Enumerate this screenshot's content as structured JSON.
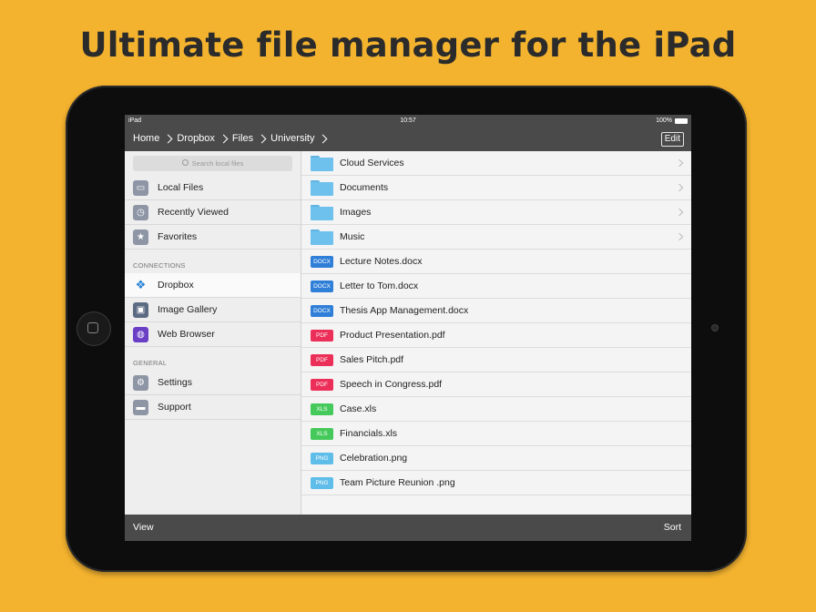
{
  "headline": "Ultimate file manager for the iPad",
  "status_bar": {
    "carrier": "iPad",
    "time": "10:57",
    "battery": "100%"
  },
  "nav": {
    "breadcrumbs": [
      "Home",
      "Dropbox",
      "Files",
      "University"
    ],
    "edit_label": "Edit"
  },
  "sidebar": {
    "search_placeholder": "Search local files",
    "items": [
      {
        "label": "Local Files",
        "icon": "folder-icon",
        "color": "#8e96a6"
      },
      {
        "label": "Recently Viewed",
        "icon": "clock-icon",
        "color": "#8e96a6"
      },
      {
        "label": "Favorites",
        "icon": "star-icon",
        "color": "#8e96a6"
      }
    ],
    "connections_header": "CONNECTIONS",
    "connections": [
      {
        "label": "Dropbox",
        "icon": "dropbox-icon",
        "color": "#2b84d8",
        "selected": true
      },
      {
        "label": "Image Gallery",
        "icon": "image-icon",
        "color": "#5b6b82"
      },
      {
        "label": "Web Browser",
        "icon": "globe-icon",
        "color": "#6a3fc6"
      }
    ],
    "general_header": "GENERAL",
    "general": [
      {
        "label": "Settings",
        "icon": "gear-icon",
        "color": "#8e96a6"
      },
      {
        "label": "Support",
        "icon": "chat-icon",
        "color": "#8e96a6"
      }
    ]
  },
  "files": [
    {
      "name": "Cloud Services",
      "type": "folder"
    },
    {
      "name": "Documents",
      "type": "folder"
    },
    {
      "name": "Images",
      "type": "folder"
    },
    {
      "name": "Music",
      "type": "folder"
    },
    {
      "name": "Lecture Notes.docx",
      "type": "DOCX",
      "color": "#2f7fd8"
    },
    {
      "name": "Letter to Tom.docx",
      "type": "DOCX",
      "color": "#2f7fd8"
    },
    {
      "name": "Thesis App Management.docx",
      "type": "DOCX",
      "color": "#2f7fd8"
    },
    {
      "name": "Product Presentation.pdf",
      "type": "PDF",
      "color": "#ec2f59"
    },
    {
      "name": "Sales Pitch.pdf",
      "type": "PDF",
      "color": "#ec2f59"
    },
    {
      "name": "Speech in Congress.pdf",
      "type": "PDF",
      "color": "#ec2f59"
    },
    {
      "name": "Case.xls",
      "type": "XLS",
      "color": "#45c95a"
    },
    {
      "name": "Financials.xls",
      "type": "XLS",
      "color": "#45c95a"
    },
    {
      "name": "Celebration.png",
      "type": "PNG",
      "color": "#5fbde9"
    },
    {
      "name": "Team Picture Reunion .png",
      "type": "PNG",
      "color": "#5fbde9"
    }
  ],
  "toolbar": {
    "view_label": "View",
    "sort_label": "Sort"
  }
}
